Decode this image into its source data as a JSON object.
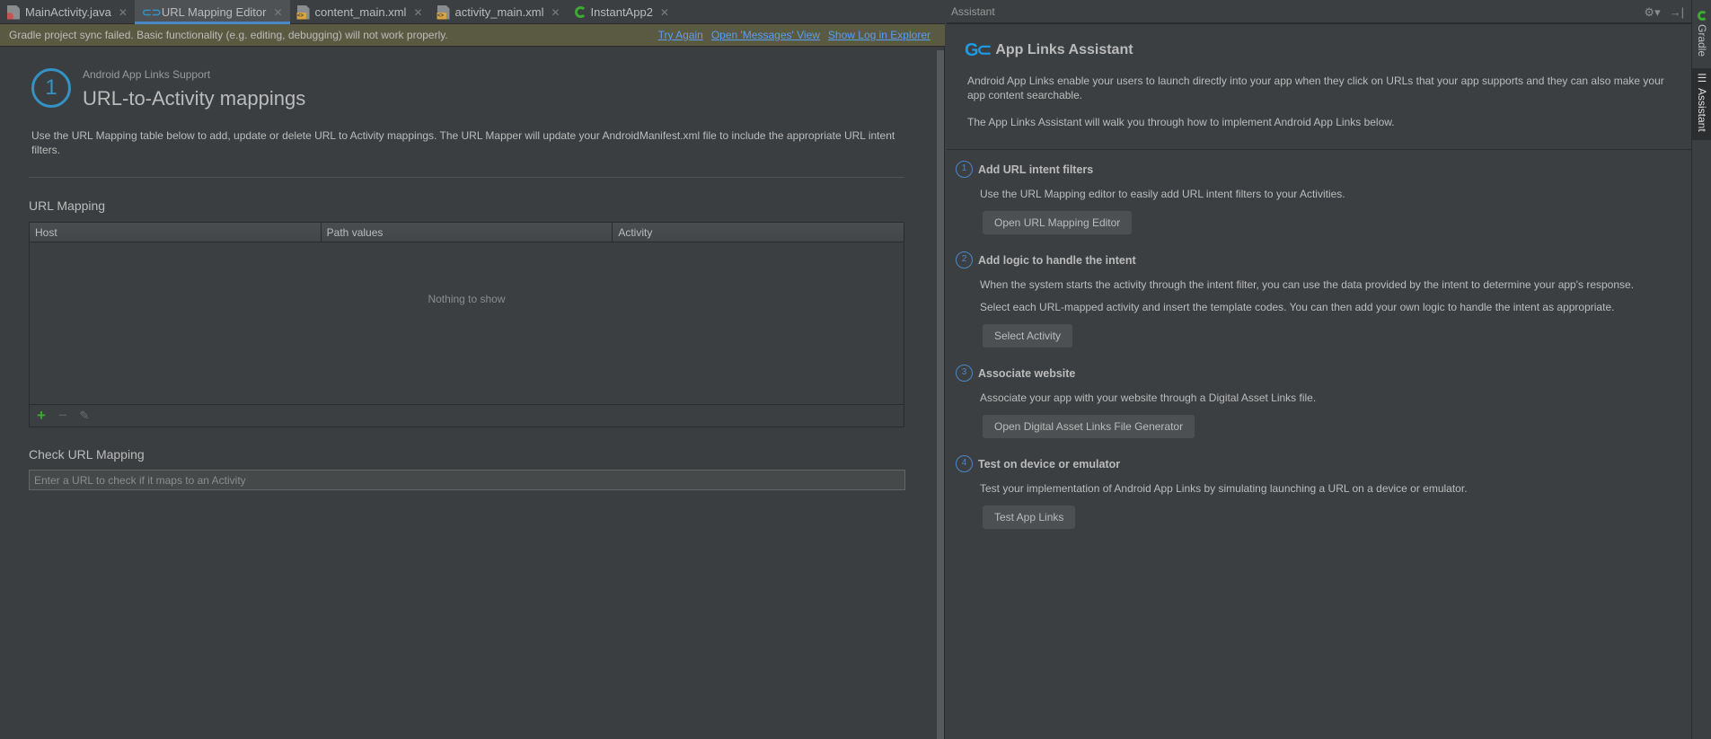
{
  "tabs": [
    {
      "label": "MainActivity.java",
      "icon": "java-file-icon",
      "active": false
    },
    {
      "label": "URL Mapping Editor",
      "icon": "link-icon",
      "active": true
    },
    {
      "label": "content_main.xml",
      "icon": "xml-file-icon",
      "active": false
    },
    {
      "label": "activity_main.xml",
      "icon": "xml-file-icon",
      "active": false
    },
    {
      "label": "InstantApp2",
      "icon": "android-module-icon",
      "active": false
    }
  ],
  "notification": {
    "message": "Gradle project sync failed. Basic functionality (e.g. editing, debugging) will not work properly.",
    "links": [
      "Try Again",
      "Open 'Messages' View",
      "Show Log in Explorer"
    ]
  },
  "editor": {
    "step_number": "1",
    "subtitle": "Android App Links Support",
    "title": "URL-to-Activity mappings",
    "description": "Use the URL Mapping table below to add, update or delete URL to Activity mappings. The URL Mapper will update your AndroidManifest.xml file to include the appropriate URL intent filters.",
    "url_mapping_label": "URL Mapping",
    "table_columns": [
      "Host",
      "Path values",
      "Activity"
    ],
    "empty_text": "Nothing to show",
    "toolbar": {
      "add": "+",
      "remove": "−",
      "edit": "✎"
    },
    "check_label": "Check URL Mapping",
    "check_placeholder": "Enter a URL to check if it maps to an Activity"
  },
  "assistant": {
    "header": "Assistant",
    "title": "App Links Assistant",
    "logo": "G⊂",
    "intro1": "Android App Links enable your users to launch directly into your app when they click on URLs that your app supports and they can also make your app content searchable.",
    "intro2": "The App Links Assistant will walk you through how to implement Android App Links below.",
    "steps": [
      {
        "num": "1",
        "title": "Add URL intent filters",
        "texts": [
          "Use the URL Mapping editor to easily add URL intent filters to your Activities."
        ],
        "button": "Open URL Mapping Editor"
      },
      {
        "num": "2",
        "title": "Add logic to handle the intent",
        "texts": [
          "When the system starts the activity through the intent filter, you can use the data provided by the intent to determine your app's response.",
          "Select each URL-mapped activity and insert the template codes. You can then add your own logic to handle the intent as appropriate."
        ],
        "button": "Select Activity"
      },
      {
        "num": "3",
        "title": "Associate website",
        "texts": [
          "Associate your app with your website through a Digital Asset Links file."
        ],
        "button": "Open Digital Asset Links File Generator"
      },
      {
        "num": "4",
        "title": "Test on device or emulator",
        "texts": [
          "Test your implementation of Android App Links by simulating launching a URL on a device or emulator."
        ],
        "button": "Test App Links"
      }
    ]
  },
  "side_strip": {
    "gradle": "Gradle",
    "assistant": "Assistant"
  },
  "colors": {
    "accent": "#3592c4",
    "link": "#589df6",
    "notification_bg": "#5a5a42",
    "add_green": "#3ea834"
  }
}
